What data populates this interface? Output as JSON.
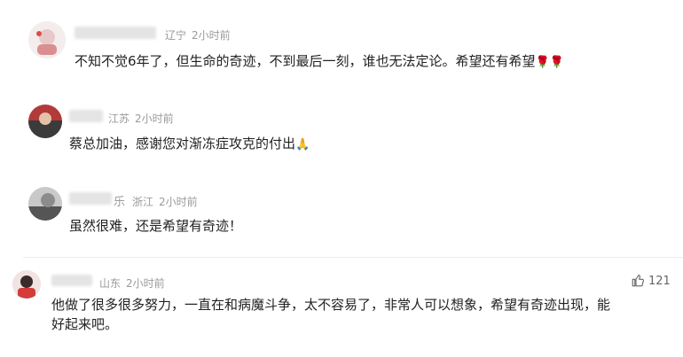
{
  "comments": [
    {
      "name_suffix": "",
      "location": "辽宁",
      "time": "2小时前",
      "text": "不知不觉6年了，但生命的奇迹，不到最后一刻，谁也无法定论。希望还有希望",
      "emoji": "🌹🌹"
    },
    {
      "name_suffix": "",
      "location": "江苏",
      "time": "2小时前",
      "text": "蔡总加油，感谢您对渐冻症攻克的付出",
      "emoji": "🙏"
    },
    {
      "name_suffix": "乐",
      "location": "浙江",
      "time": "2小时前",
      "text": "虽然很难，还是希望有奇迹！",
      "emoji": ""
    },
    {
      "name_suffix": "",
      "location": "山东",
      "time": "2小时前",
      "text_line1": "他做了很多很多努力，一直在和病魔斗争，太不容易了，非常人可以想象，希望有奇迹出现，能",
      "text_line2": "好起来吧。",
      "likes": "121"
    }
  ],
  "icons": {
    "like": "thumbs-up-icon"
  }
}
